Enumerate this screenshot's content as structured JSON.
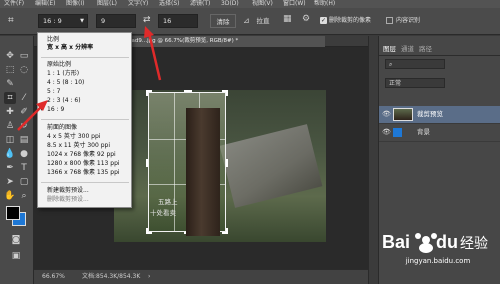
{
  "menubar": {
    "items": [
      "文件(F)",
      "编辑(E)",
      "图像(I)",
      "图层(L)",
      "文字(Y)",
      "选择(S)",
      "滤镜(T)",
      "3D(D)",
      "视图(V)",
      "窗口(W)",
      "帮助(H)"
    ]
  },
  "options": {
    "ratio_value": "16 : 9",
    "width_value": "9",
    "height_value": "16",
    "clear_label": "清除",
    "straighten_label": "拉直",
    "delete_pixels_label": "删除裁剪的像素",
    "content_aware_label": "内容识别"
  },
  "tab": {
    "title": "c1ad9...jpg @ 66.7%(裁剪预览, RGB/8#) *"
  },
  "dropdown": {
    "items": [
      {
        "label": "比例",
        "checked": false
      },
      {
        "label": "宽 x 高 x 分辨率",
        "checked": false
      },
      {
        "label": "原始比例",
        "checked": false
      },
      {
        "label": "1 : 1 (方形)",
        "checked": false
      },
      {
        "label": "4 : 5 (8 : 10)",
        "checked": false
      },
      {
        "label": "5 : 7",
        "checked": false
      },
      {
        "label": "2 : 3 (4 : 6)",
        "checked": false
      },
      {
        "label": "16 : 9",
        "checked": true
      },
      {
        "label": "前面的图像",
        "checked": false
      },
      {
        "label": "4 x 5 英寸 300 ppi",
        "checked": false
      },
      {
        "label": "8.5 x 11 英寸 300 ppi",
        "checked": false
      },
      {
        "label": "1024 x 768 像素 92 ppi",
        "checked": false
      },
      {
        "label": "1280 x 800 像素 113 ppi",
        "checked": false
      },
      {
        "label": "1366 x 768 像素 135 ppi",
        "checked": false
      },
      {
        "label": "新建裁剪预设...",
        "checked": false
      },
      {
        "label": "删除裁剪预设...",
        "checked": false
      }
    ]
  },
  "panel": {
    "tabs": [
      "图层",
      "通道",
      "路径"
    ],
    "blend_mode": "正常",
    "layers": [
      {
        "name": "裁剪预览"
      },
      {
        "name": "背景"
      }
    ]
  },
  "canvas": {
    "poem_line1": "五路上",
    "poem_line2": "十处看卖"
  },
  "status": {
    "zoom": "66.67%",
    "doc_info": "文档:854.3K/854.3K"
  },
  "watermark": {
    "logo_text": "Baidu 经验",
    "url": "jingyan.baidu.com"
  },
  "colors": {
    "accent": "#3d7ebd",
    "annotation_arrow": "#e02a2a",
    "selected_layer": "#5a6d88"
  }
}
